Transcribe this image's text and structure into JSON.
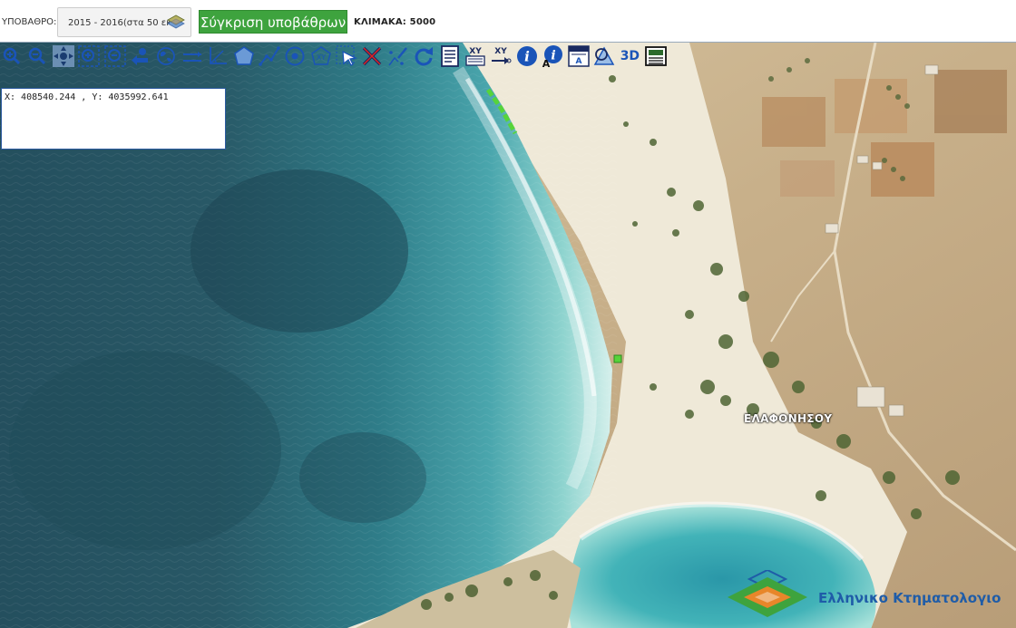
{
  "topbar": {
    "basemap_label": "ΥΠΟΒΑΘΡΟ:",
    "basemap_value": "2015 - 2016(στα 50 εκ)",
    "compare_button": "Σύγκριση υποβάθρων",
    "scale_label": "ΚΛΙΜΑΚΑ: 5000"
  },
  "toolbar": {
    "tools": [
      {
        "name": "zoom-in-icon"
      },
      {
        "name": "zoom-out-icon"
      },
      {
        "name": "pan-icon"
      },
      {
        "name": "zoom-box-in-icon"
      },
      {
        "name": "zoom-box-out-icon"
      },
      {
        "name": "previous-extent-icon"
      },
      {
        "name": "full-extent-icon"
      },
      {
        "name": "measure-distance-icon"
      },
      {
        "name": "measure-angle-icon"
      },
      {
        "name": "measure-area-icon"
      },
      {
        "name": "draw-line-icon"
      },
      {
        "name": "draw-circle-icon"
      },
      {
        "name": "draw-polygon-icon"
      },
      {
        "name": "select-icon"
      },
      {
        "name": "clear-icon"
      },
      {
        "name": "edit-point-icon"
      },
      {
        "name": "refresh-icon"
      },
      {
        "name": "document-icon"
      },
      {
        "name": "xy-list-icon"
      },
      {
        "name": "xy-goto-icon"
      },
      {
        "name": "info-icon"
      },
      {
        "name": "info-text-icon"
      },
      {
        "name": "text-layer-icon"
      },
      {
        "name": "identify-area-icon"
      },
      {
        "name": "3d-view-icon"
      },
      {
        "name": "print-icon"
      }
    ],
    "label_3d": "3D",
    "label_xy": "XY",
    "label_i": "i",
    "label_a": "A"
  },
  "map": {
    "coordinates": "X: 408540.244 , Y: 4035992.641",
    "place_label": "ΕΛΑΦΟΝΗΣΟΥ",
    "logo_text": "Ελληνικο Κτηματολογιο",
    "colors": {
      "sea_deep": "#1f4e60",
      "sea_mid": "#2e7c8a",
      "sea_shallow": "#58b5b8",
      "sand": "#efe9d8",
      "land": "#c9b08a",
      "vegetation": "#4f6534",
      "highlight": "#56d43a",
      "brand_blue": "#1f5ca8",
      "brand_green": "#3ea33e",
      "brand_orange": "#e8862a"
    }
  }
}
